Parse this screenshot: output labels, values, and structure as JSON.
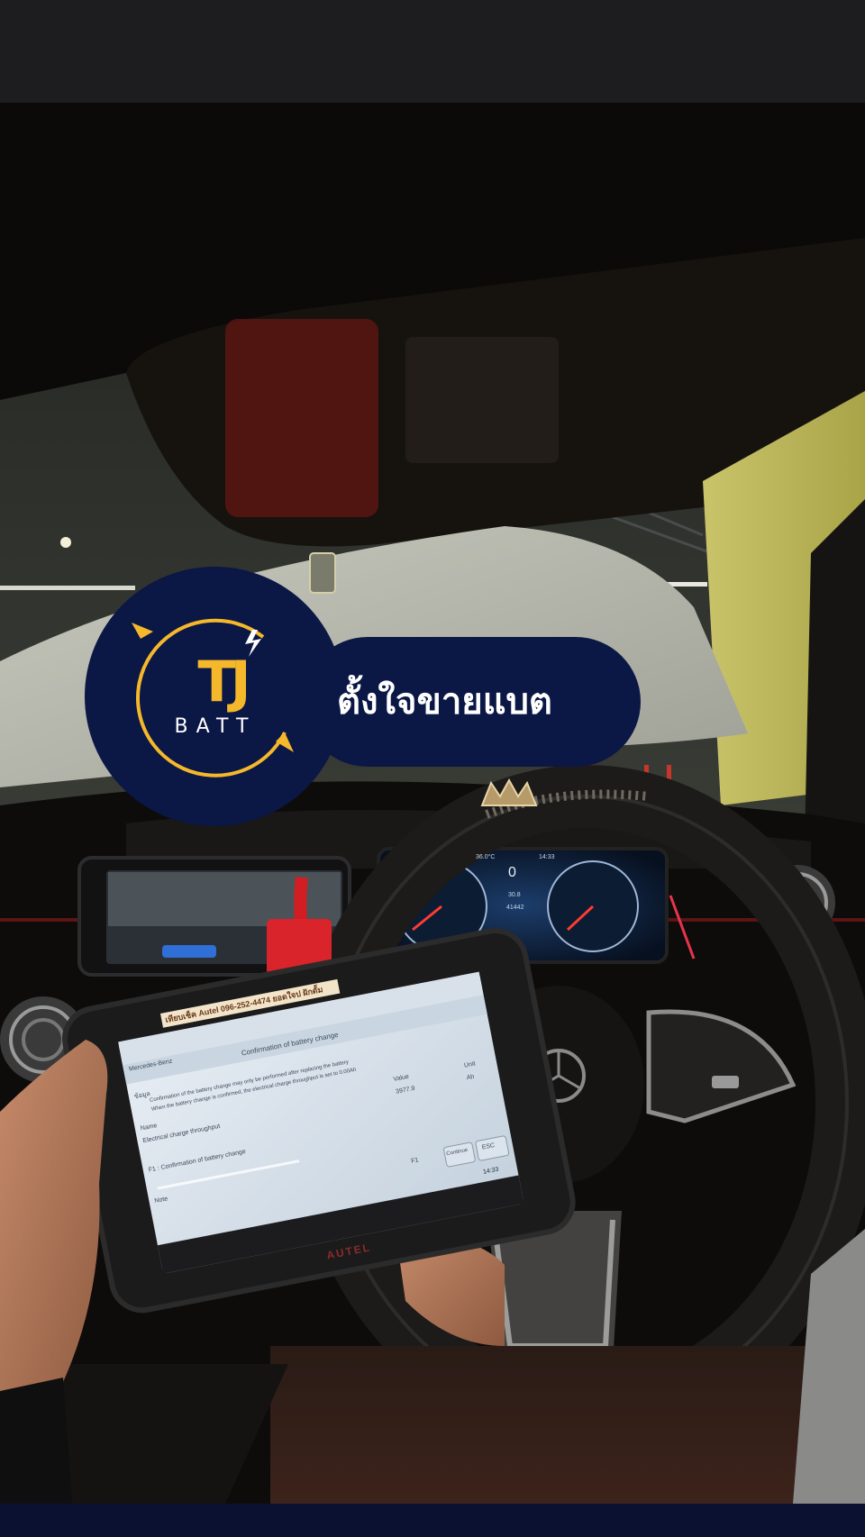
{
  "brand": {
    "logo_letters": "TJ",
    "logo_subtitle": "BATT",
    "name": "ตั้งใจขายแบต"
  },
  "scan_tool": {
    "sticker": "เทียบเช็ค Autel 096-252-4474 ยอดใจป ฝักดั้ม",
    "vehicle": "Mercedes-Benz",
    "screen_title": "Confirmation of battery change",
    "info_label": "ข้อมูล",
    "info_line_1": "Confirmation of the battery change may only be performed after replacing the battery",
    "info_line_2": "When the battery change is confirmed, the electrical charge throughput is set to 0.00Ah",
    "col_name": "Name",
    "col_value": "Value",
    "col_unit": "Unit",
    "row_name": "Electrical charge throughput",
    "row_value": "3977.9",
    "row_unit": "Ah",
    "f1_text": "F1 : Confirmation of battery change",
    "note_label": "Note",
    "btn_f1": "F1",
    "btn_continue": "Continue",
    "btn_esc": "ESC",
    "status_time": "14:33",
    "brand": "AUTEL"
  },
  "cluster": {
    "temperature": "36.0°C",
    "time": "14:33",
    "speed": "0",
    "trip": "30.8",
    "odometer": "41442"
  }
}
